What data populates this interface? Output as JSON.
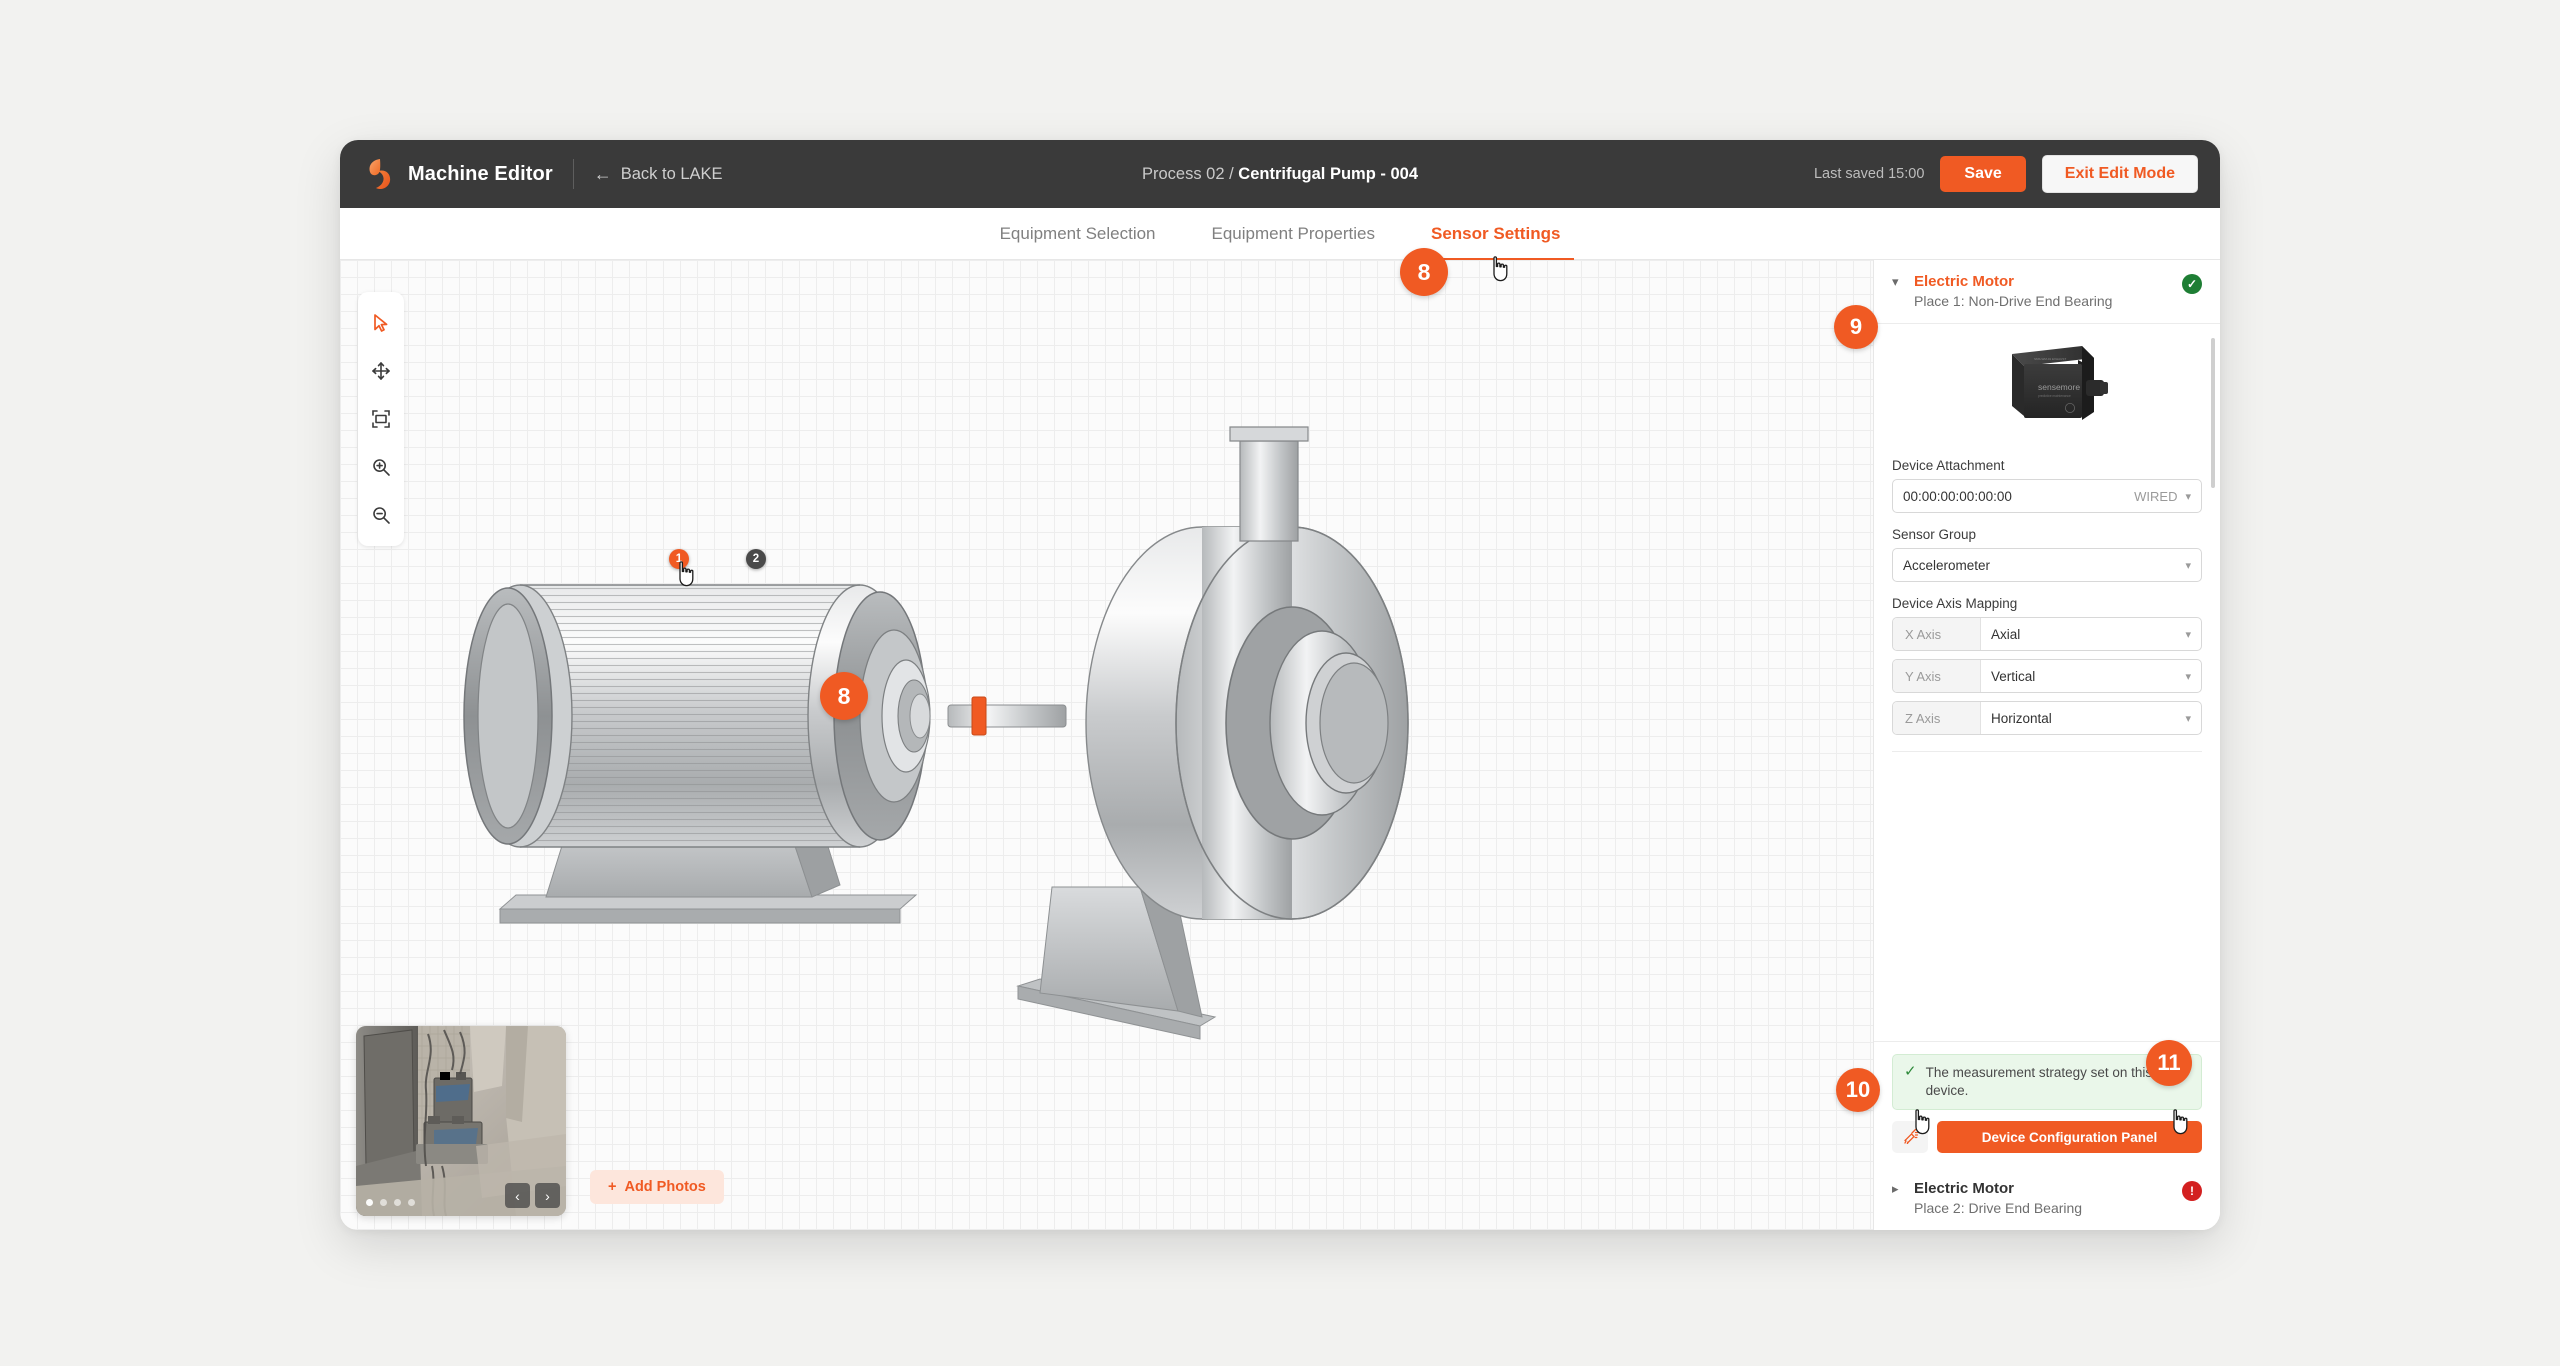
{
  "header": {
    "app_title": "Machine Editor",
    "back_label": "Back to LAKE",
    "breadcrumb_prefix": "Process 02 / ",
    "breadcrumb_current": "Centrifugal Pump - 004",
    "last_saved": "Last saved 15:00",
    "save_label": "Save",
    "exit_label": "Exit Edit Mode",
    "logo_icon": "sensemore-logo-icon",
    "back_icon": "arrow-left-icon"
  },
  "tabs": [
    {
      "label": "Equipment Selection",
      "active": false
    },
    {
      "label": "Equipment Properties",
      "active": false
    },
    {
      "label": "Sensor Settings",
      "active": true
    }
  ],
  "toolbar": {
    "items": [
      {
        "icon": "cursor-select-icon",
        "active": true
      },
      {
        "icon": "pan-move-icon",
        "active": false
      },
      {
        "icon": "fit-to-screen-icon",
        "active": false
      },
      {
        "icon": "zoom-in-icon",
        "active": false
      },
      {
        "icon": "zoom-out-icon",
        "active": false
      }
    ]
  },
  "canvas": {
    "machine_name": "centrifugal-pump-assembly",
    "sensor_markers": [
      {
        "label": "1",
        "state": "selected"
      },
      {
        "label": "2",
        "state": "idle"
      }
    ]
  },
  "photos": {
    "add_label": "Add Photos",
    "add_icon": "plus-icon",
    "prev_icon": "chevron-left-icon",
    "next_icon": "chevron-right-icon",
    "dot_count": 4,
    "active_dot": 0
  },
  "right_panel": {
    "devices": [
      {
        "name": "Electric Motor",
        "place": "Place 1: Non-Drive End Bearing",
        "expanded": true,
        "status": "ok",
        "status_icon": "check-circle-icon",
        "chevron_icon": "chevron-down-icon"
      },
      {
        "name": "Electric Motor",
        "place": "Place 2: Drive End Bearing",
        "expanded": false,
        "status": "error",
        "status_icon": "alert-circle-icon",
        "chevron_icon": "chevron-right-icon"
      }
    ],
    "device_image_alt": "sensemore-sensor-device",
    "fields": {
      "device_attachment_label": "Device Attachment",
      "device_attachment_value": "00:00:00:00:00:00",
      "device_attachment_suffix": "WIRED",
      "sensor_group_label": "Sensor Group",
      "sensor_group_value": "Accelerometer",
      "axis_mapping_label": "Device Axis Mapping",
      "axes": [
        {
          "key": "X Axis",
          "value": "Axial"
        },
        {
          "key": "Y Axis",
          "value": "Vertical"
        },
        {
          "key": "Z Axis",
          "value": "Horizontal"
        }
      ]
    },
    "alert": {
      "icon": "check-icon",
      "text": "The measurement strategy set on this device."
    },
    "actions": {
      "clear_icon": "clear-strategy-icon",
      "config_label": "Device Configuration Panel"
    }
  },
  "step_badges": [
    {
      "label": "8",
      "target": "tab-sensor-settings"
    },
    {
      "label": "8",
      "target": "machine-sensor-marker-1"
    },
    {
      "label": "9",
      "target": "device-panel-electric-motor-1"
    },
    {
      "label": "10",
      "target": "clear-strategy-button"
    },
    {
      "label": "11",
      "target": "measurement-strategy-alert"
    }
  ]
}
